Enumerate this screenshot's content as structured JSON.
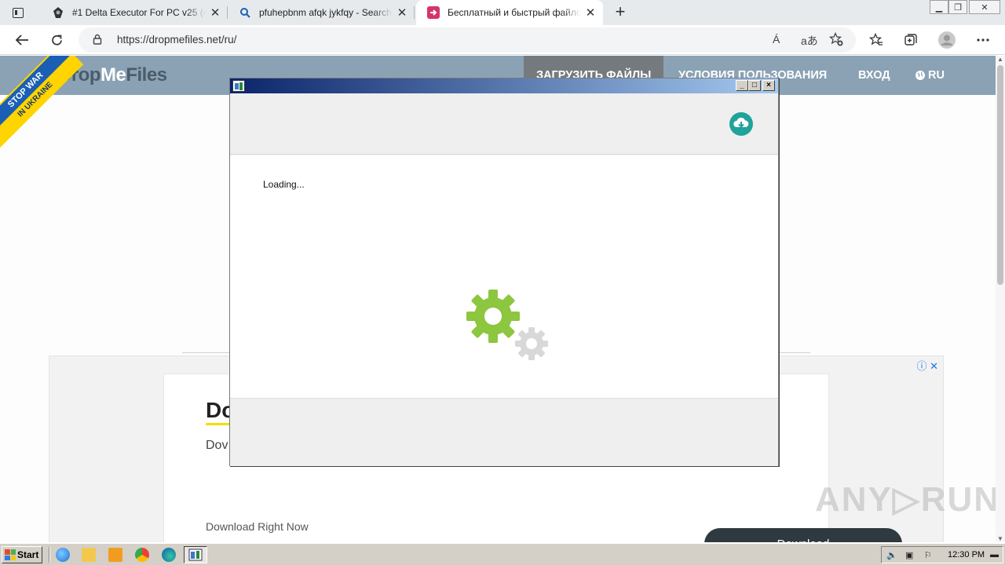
{
  "browser": {
    "tabs": [
      {
        "title": "#1 Delta Executor For PC v25 (e",
        "favicon": "delta-favicon"
      },
      {
        "title": "pfuhepbnm afqk jykfqy - Search",
        "favicon": "search-favicon"
      },
      {
        "title": "Бесплатный и быстрый файлообменник",
        "favicon": "dropmefiles-favicon"
      }
    ],
    "close_glyph": "✕",
    "new_tab_glyph": "+",
    "window_controls": [
      "▁",
      "❐",
      "✕"
    ],
    "url": "https://dropmefiles.net/ru/",
    "address_icons": [
      "Á",
      "aあ"
    ]
  },
  "site": {
    "logo_prefix": "Drop",
    "logo_me": "Me",
    "logo_suffix": "Files",
    "banner_top": "STOP WAR",
    "banner_bottom": "IN UKRAINE",
    "nav": {
      "upload": "ЗАГРУЗИТЬ ФАЙЛЫ",
      "terms": "УСЛОВИЯ ПОЛЬЗОВАНИЯ",
      "login": "ВХОД",
      "lang": "RU"
    }
  },
  "ad": {
    "title": "Do",
    "subtitle": "Dov",
    "link": "Download Right Now",
    "button": "Download",
    "icons": "ⓘ ✕"
  },
  "watermark": "ANY▷RUN",
  "dialog": {
    "loading_text": "Loading...",
    "controls": [
      "_",
      "□",
      "×"
    ]
  },
  "taskbar": {
    "start_label": "Start",
    "clock": "12:30 PM"
  },
  "colors": {
    "header": "#8aa2b4",
    "gear_green": "#8dc63f",
    "gear_gray": "#d8d8d8",
    "download_teal": "#1fa39a",
    "ad_button": "#2e3a40"
  }
}
